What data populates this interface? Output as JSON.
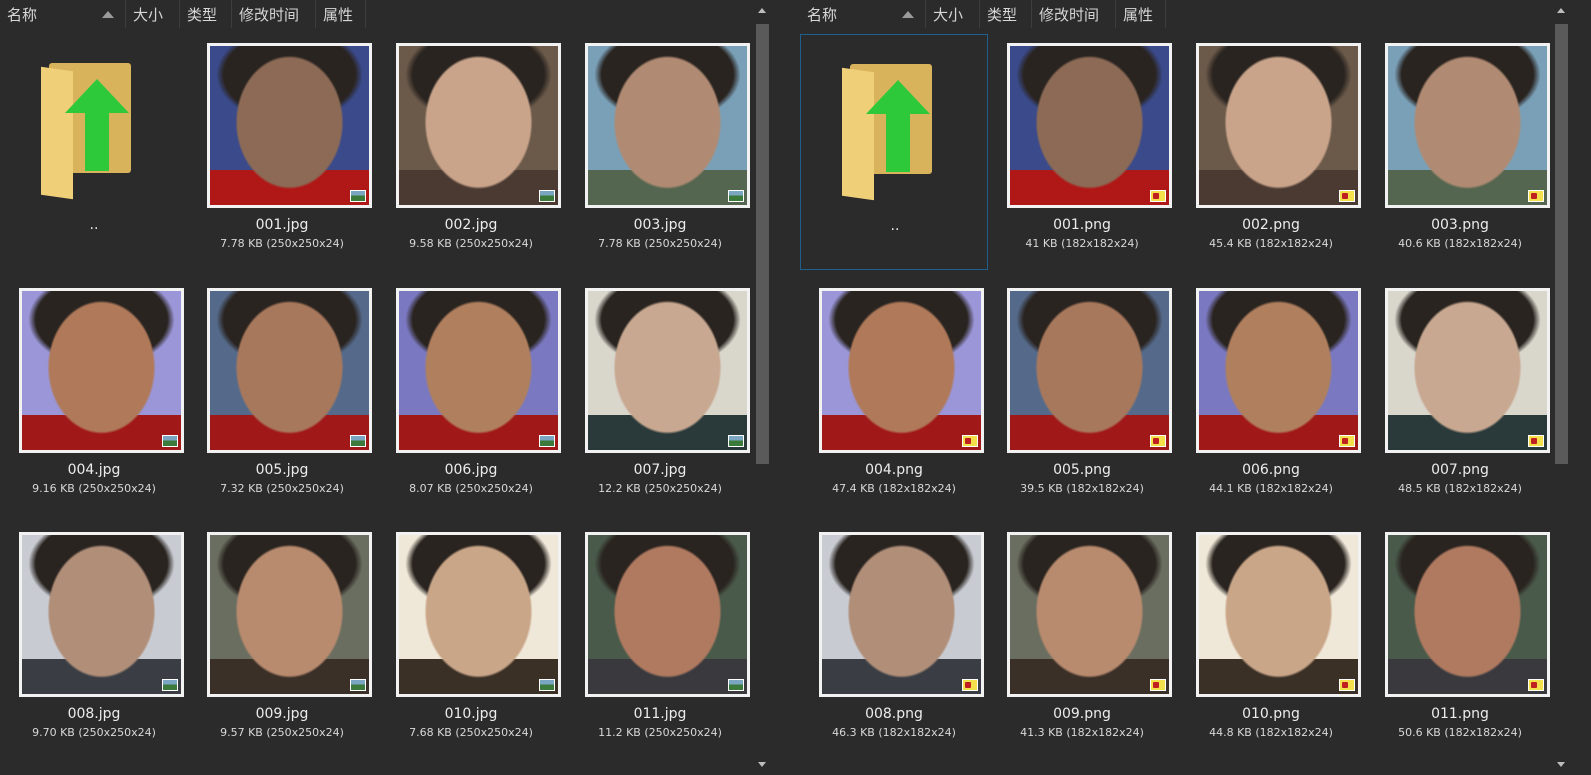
{
  "panes": [
    {
      "id": "left",
      "headers": {
        "name": "名称",
        "size": "大小",
        "type": "类型",
        "modified": "修改时间",
        "attributes": "属性"
      },
      "parent": {
        "label": ".."
      },
      "files": [
        {
          "name": "001.jpg",
          "meta": "7.78 KB (250x250x24)"
        },
        {
          "name": "002.jpg",
          "meta": "9.58 KB (250x250x24)"
        },
        {
          "name": "003.jpg",
          "meta": "7.78 KB (250x250x24)"
        },
        {
          "name": "004.jpg",
          "meta": "9.16 KB (250x250x24)"
        },
        {
          "name": "005.jpg",
          "meta": "7.32 KB (250x250x24)"
        },
        {
          "name": "006.jpg",
          "meta": "8.07 KB (250x250x24)"
        },
        {
          "name": "007.jpg",
          "meta": "12.2 KB (250x250x24)"
        },
        {
          "name": "008.jpg",
          "meta": "9.70 KB (250x250x24)"
        },
        {
          "name": "009.jpg",
          "meta": "9.57 KB (250x250x24)"
        },
        {
          "name": "010.jpg",
          "meta": "7.68 KB (250x250x24)"
        },
        {
          "name": "011.jpg",
          "meta": "11.2 KB (250x250x24)"
        }
      ]
    },
    {
      "id": "right",
      "headers": {
        "name": "名称",
        "size": "大小",
        "type": "类型",
        "modified": "修改时间",
        "attributes": "属性"
      },
      "parent": {
        "label": ".."
      },
      "files": [
        {
          "name": "001.png",
          "meta": "41 KB (182x182x24)"
        },
        {
          "name": "002.png",
          "meta": "45.4 KB (182x182x24)"
        },
        {
          "name": "003.png",
          "meta": "40.6 KB (182x182x24)"
        },
        {
          "name": "004.png",
          "meta": "47.4 KB (182x182x24)"
        },
        {
          "name": "005.png",
          "meta": "39.5 KB (182x182x24)"
        },
        {
          "name": "006.png",
          "meta": "44.1 KB (182x182x24)"
        },
        {
          "name": "007.png",
          "meta": "48.5 KB (182x182x24)"
        },
        {
          "name": "008.png",
          "meta": "46.3 KB (182x182x24)"
        },
        {
          "name": "009.png",
          "meta": "41.3 KB (182x182x24)"
        },
        {
          "name": "010.png",
          "meta": "44.8 KB (182x182x24)"
        },
        {
          "name": "011.png",
          "meta": "50.6 KB (182x182x24)"
        }
      ]
    }
  ],
  "colors": {
    "background": "#2b2b2b",
    "selection_border": "#1f5f8c",
    "folder": "#d9b35c",
    "up_arrow": "#2ec93a"
  },
  "icons": {
    "parent_folder": "folder-up-arrow-icon",
    "jpg_badge": "image-file-icon",
    "png_badge": "png-file-icon",
    "sort": "sort-ascending-icon"
  }
}
